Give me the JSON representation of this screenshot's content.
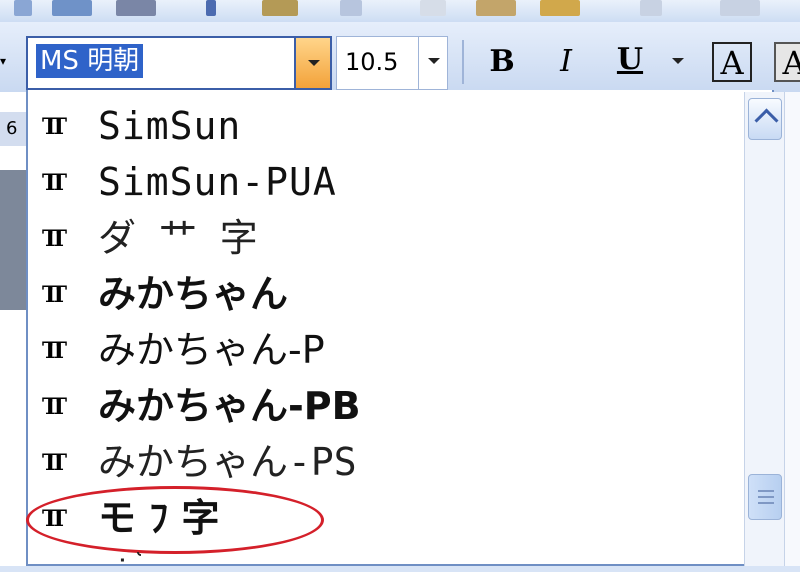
{
  "toolbar": {
    "font_name": "MS 明朝",
    "font_size": "10.5",
    "bold_label": "B",
    "italic_label": "I",
    "underline_label": "U",
    "char_border_label": "A",
    "char_shading_label": "A"
  },
  "ruler": {
    "number": "6"
  },
  "font_list": {
    "icon_glyph": "TT",
    "items": [
      {
        "label": "SimSun"
      },
      {
        "label": "SimSun-PUA"
      },
      {
        "label": "ダ ⺾ 字"
      },
      {
        "label": "みかちゃん"
      },
      {
        "label": "みかちゃん-P"
      },
      {
        "label": "みかちゃん-PB"
      },
      {
        "label": "みかちゃん-PS"
      },
      {
        "label": "モ ﾌ 字"
      }
    ]
  },
  "colors": {
    "selection": "#2f63c9",
    "accent_border": "#3b5ea8",
    "dropdown_button": "#f3a23a",
    "annotation": "#d4202a",
    "toolbar_bg": "#c9d9f1"
  },
  "icons": [
    "truetype-font-icon",
    "dropdown-arrow-icon",
    "scroll-up-icon",
    "scroll-thumb-grip-icon"
  ]
}
